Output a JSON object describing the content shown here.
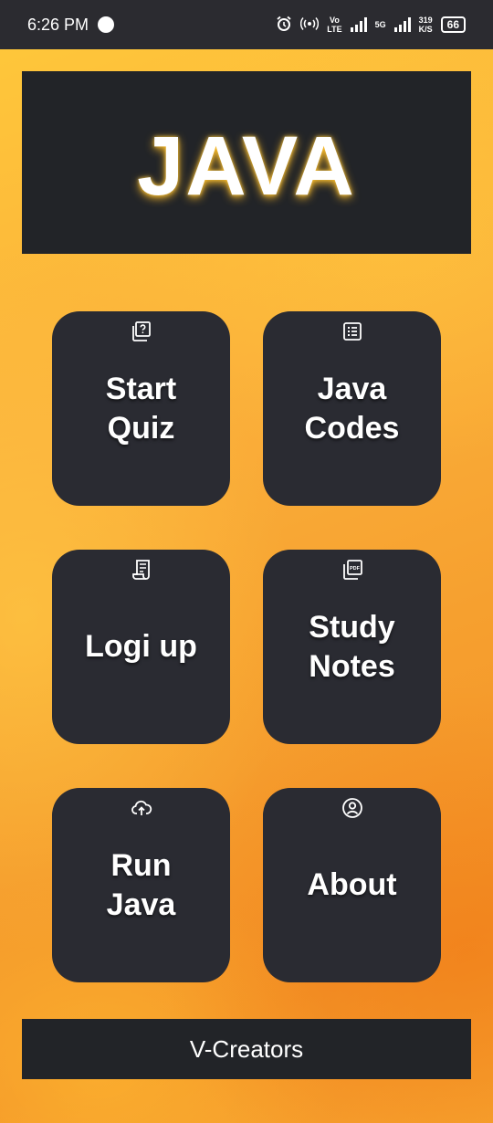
{
  "status_bar": {
    "time": "6:26 PM",
    "volte_top": "Vo",
    "volte_bottom": "LTE",
    "network_5g": "5G",
    "speed_value": "319",
    "speed_unit": "K/S",
    "battery": "66"
  },
  "banner": {
    "title": "JAVA"
  },
  "tiles": [
    {
      "label": "Start\nQuiz",
      "icon": "quiz-icon"
    },
    {
      "label": "Java\nCodes",
      "icon": "list-icon"
    },
    {
      "label": "Logi up",
      "icon": "receipt-icon"
    },
    {
      "label": "Study\nNotes",
      "icon": "pdf-icon"
    },
    {
      "label": "Run\nJava",
      "icon": "cloud-upload-icon"
    },
    {
      "label": "About",
      "icon": "account-icon"
    }
  ],
  "footer": {
    "text": "V-Creators"
  },
  "colors": {
    "tile_bg": "#2a2b32",
    "banner_bg": "#222428",
    "status_bg": "#2b2b30",
    "glow": "#ffbe28"
  }
}
